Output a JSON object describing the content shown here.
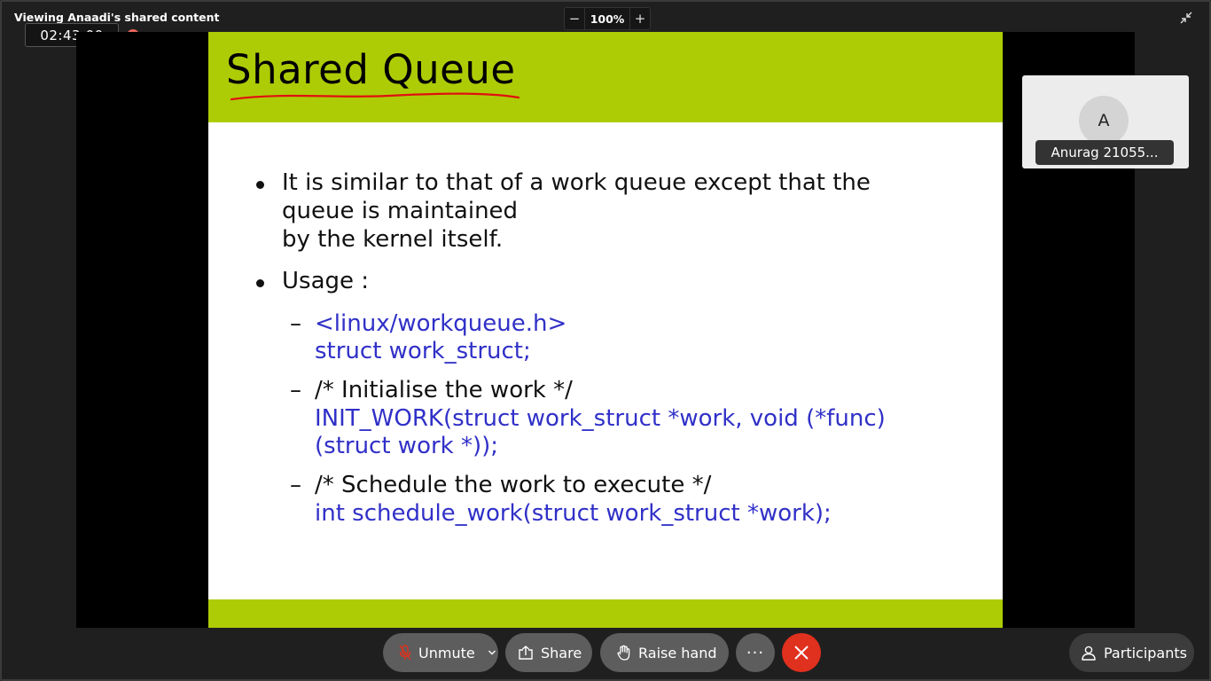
{
  "app": {
    "share_title": "Viewing Anaadi's shared content",
    "timer": "02:43:00",
    "zoom": {
      "decrease": "−",
      "value": "100%",
      "increase": "+"
    }
  },
  "slide": {
    "title": "Shared Queue",
    "bullets": [
      {
        "lines": [
          "It is similar to that of a work queue except that the",
          "queue is maintained",
          "by the kernel itself."
        ]
      },
      {
        "lines": [
          "Usage :"
        ]
      }
    ],
    "sub_items": [
      {
        "dash": "–",
        "lines": [
          {
            "text": "<linux/workqueue.h>",
            "color": "#3030c8"
          },
          {
            "text": "struct work_struct;",
            "color": "#3030c8"
          }
        ]
      },
      {
        "dash": "–",
        "lines": [
          {
            "text": "/* Initialise the work */",
            "color": "#111111"
          },
          {
            "text": "INIT_WORK(struct work_struct *work, void (*func)",
            "color": "#3030c8"
          },
          {
            "text": "(struct work *));",
            "color": "#3030c8"
          }
        ]
      },
      {
        "dash": "–",
        "lines": [
          {
            "text": "/* Schedule the work to execute */",
            "color": "#111111"
          },
          {
            "text": "int schedule_work(struct work_struct *work);",
            "color": "#3030c8"
          }
        ]
      }
    ],
    "colors": {
      "header": "#aecc06",
      "accent_underline": "#e01010"
    }
  },
  "participant_tile": {
    "initial": "A",
    "name": "Anurag 21055..."
  },
  "controls": {
    "unmute_label": "Unmute",
    "share_label": "Share",
    "raise_hand_label": "Raise hand",
    "more_label": "···",
    "participants_label": "Participants",
    "leave_color": "#e0301e"
  },
  "icons": [
    "mic-muted-icon",
    "chevron-down-icon",
    "share-icon",
    "raise-hand-icon",
    "more-icon",
    "close-icon",
    "participants-icon",
    "collapse-icon",
    "record-icon"
  ]
}
